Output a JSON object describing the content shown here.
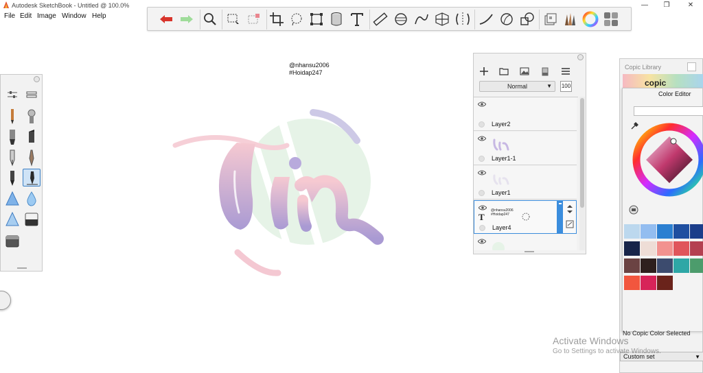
{
  "window": {
    "title": "Autodesk SketchBook - Untitled @ 100.0%",
    "controls": [
      "—",
      "❐",
      "✕"
    ]
  },
  "menu": [
    "File",
    "Edit",
    "Image",
    "Window",
    "Help"
  ],
  "toolbar": {
    "icons": [
      "undo-icon",
      "redo-icon",
      "zoom-icon",
      "select-icon",
      "fill-select-icon",
      "crop-icon",
      "lasso-icon",
      "transform-icon",
      "bucket-icon",
      "text-icon",
      "ruler-icon",
      "ellipse-guide-icon",
      "french-curve-icon",
      "perspective-icon",
      "symmetry-icon",
      "stroke-icon",
      "predictive-icon",
      "shape-icon",
      "copic-library-icon",
      "brush-library-icon",
      "color-wheel-icon",
      "palette-icon"
    ]
  },
  "canvas": {
    "watermark_line1": "@nhansu2006",
    "watermark_line2": "#Hoidap247"
  },
  "layers": {
    "blend_mode": "Normal",
    "opacity": "100",
    "items": [
      {
        "name": "",
        "kind": "empty"
      },
      {
        "name": "Layer2",
        "kind": "empty"
      },
      {
        "name": "Layer1-1",
        "kind": "art"
      },
      {
        "name": "Layer1",
        "kind": "faint"
      },
      {
        "name": "Layer4",
        "kind": "text",
        "text_line1": "@nhansu2006",
        "text_line2": "#Hoidap247"
      }
    ]
  },
  "copic_library": {
    "title": "Copic Library",
    "logo_text": "copic",
    "bottom_select": "Custom set"
  },
  "color_editor": {
    "title": "Color Editor",
    "status": "No Copic Color Selected",
    "swatches": [
      "#bcd8ee",
      "#93bdf0",
      "#2b7fd1",
      "#1f4fa0",
      "#1b3d8a",
      "#17254a",
      "#eeddd6",
      "#f2928f",
      "#e0555b",
      "#b44051",
      "#6b4343",
      "#2e201e",
      "#3c4b6e",
      "#2ea7a6",
      "#4c9c6c",
      "#f2563e",
      "#d72459",
      "#6a231b"
    ]
  },
  "activate_windows": {
    "title": "Activate Windows",
    "subtitle": "Go to Settings to activate Windows."
  }
}
